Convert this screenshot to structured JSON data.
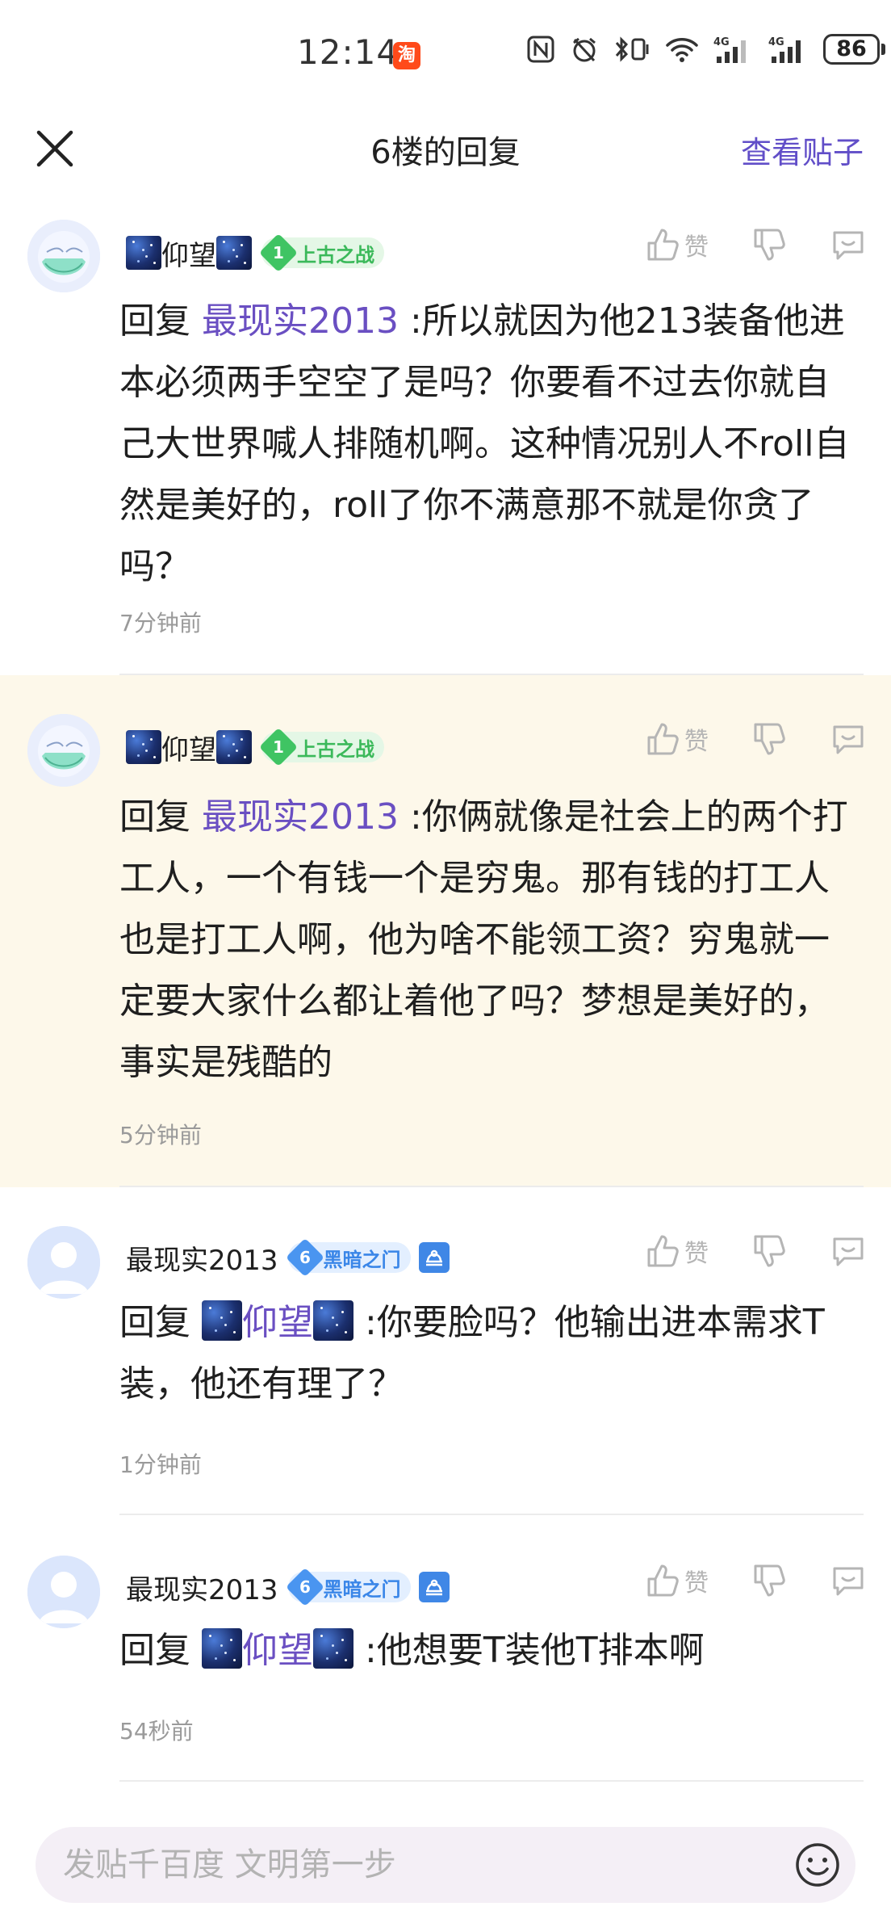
{
  "status_bar": {
    "time": "12:14",
    "taobao_badge": "淘",
    "battery": "86"
  },
  "header": {
    "title": "6楼的回复",
    "view_post": "查看贴子"
  },
  "comments": [
    {
      "username": "仰望",
      "level": "1",
      "badge": "上古之战",
      "like_label": "赞",
      "reply_prefix": "回复",
      "reply_to": "最现实2013",
      "text": ":所以就因为他213装备他进本必须两手空空了是吗？你要看不过去你就自己大世界喊人排随机啊。这种情况别人不roll自然是美好的，roll了你不满意那不就是你贪了吗？",
      "time": "7分钟前"
    },
    {
      "username": "仰望",
      "level": "1",
      "badge": "上古之战",
      "like_label": "赞",
      "reply_prefix": "回复",
      "reply_to": "最现实2013",
      "text": ":你俩就像是社会上的两个打工人，一个有钱一个是穷鬼。那有钱的打工人也是打工人啊，他为啥不能领工资？穷鬼就一定要大家什么都让着他了吗？梦想是美好的，事实是残酷的",
      "time": "5分钟前"
    },
    {
      "username": "最现实2013",
      "level": "6",
      "badge": "黑暗之门",
      "like_label": "赞",
      "reply_prefix": "回复",
      "reply_to": "仰望",
      "text": ":你要脸吗？他输出进本需求T装，他还有理了？",
      "time": "1分钟前"
    },
    {
      "username": "最现实2013",
      "level": "6",
      "badge": "黑暗之门",
      "like_label": "赞",
      "reply_prefix": "回复",
      "reply_to": "仰望",
      "text": ":他想要T装他T排本啊",
      "time": "54秒前"
    }
  ],
  "input": {
    "placeholder": "发贴千百度 文明第一步"
  },
  "colors": {
    "accent": "#614ec8",
    "highlight_bg": "#fdf8ea"
  }
}
